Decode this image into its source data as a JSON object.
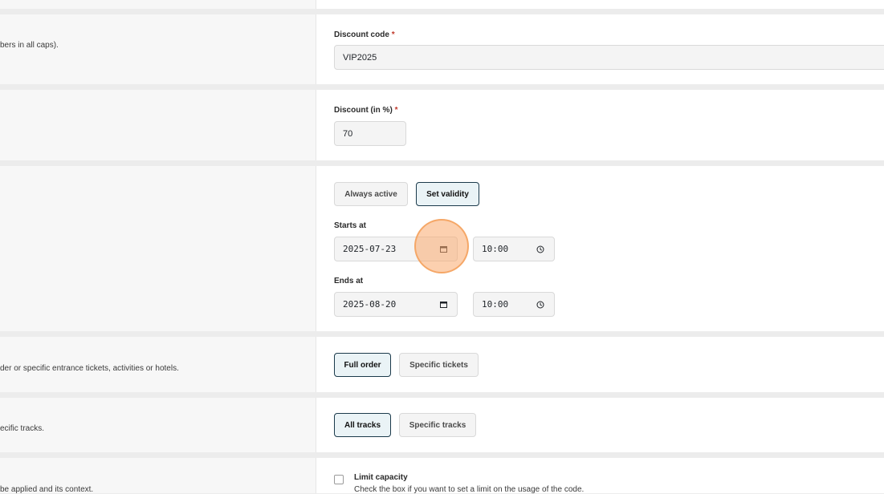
{
  "sections": {
    "code": {
      "description": "bers in all caps).",
      "label": "Discount code",
      "required": "*",
      "value": "VIP2025"
    },
    "discount": {
      "label": "Discount (in %)",
      "required": "*",
      "value": "70"
    },
    "validity": {
      "always_active": "Always active",
      "set_validity": "Set validity",
      "starts_label": "Starts at",
      "starts_date": "2025-07-23",
      "starts_time": "10:00",
      "ends_label": "Ends at",
      "ends_date": "2025-08-20",
      "ends_time": "10:00"
    },
    "scope": {
      "description": "der or specific entrance tickets, activities or hotels.",
      "full_order": "Full order",
      "specific_tickets": "Specific tickets"
    },
    "tracks": {
      "description": "ecific tracks.",
      "all_tracks": "All tracks",
      "specific_tracks": "Specific tracks"
    },
    "capacity": {
      "description": "be applied and its context.",
      "label": "Limit capacity",
      "help": "Check the box if you want to set a limit on the usage of the code."
    }
  },
  "colors": {
    "accent_border": "#1b3a4b",
    "accent_bg": "#eaf3f6",
    "required": "#c0392b",
    "cursor": "#f5a05a"
  },
  "icons": {
    "date": "calendar-icon",
    "time": "clock-icon"
  }
}
